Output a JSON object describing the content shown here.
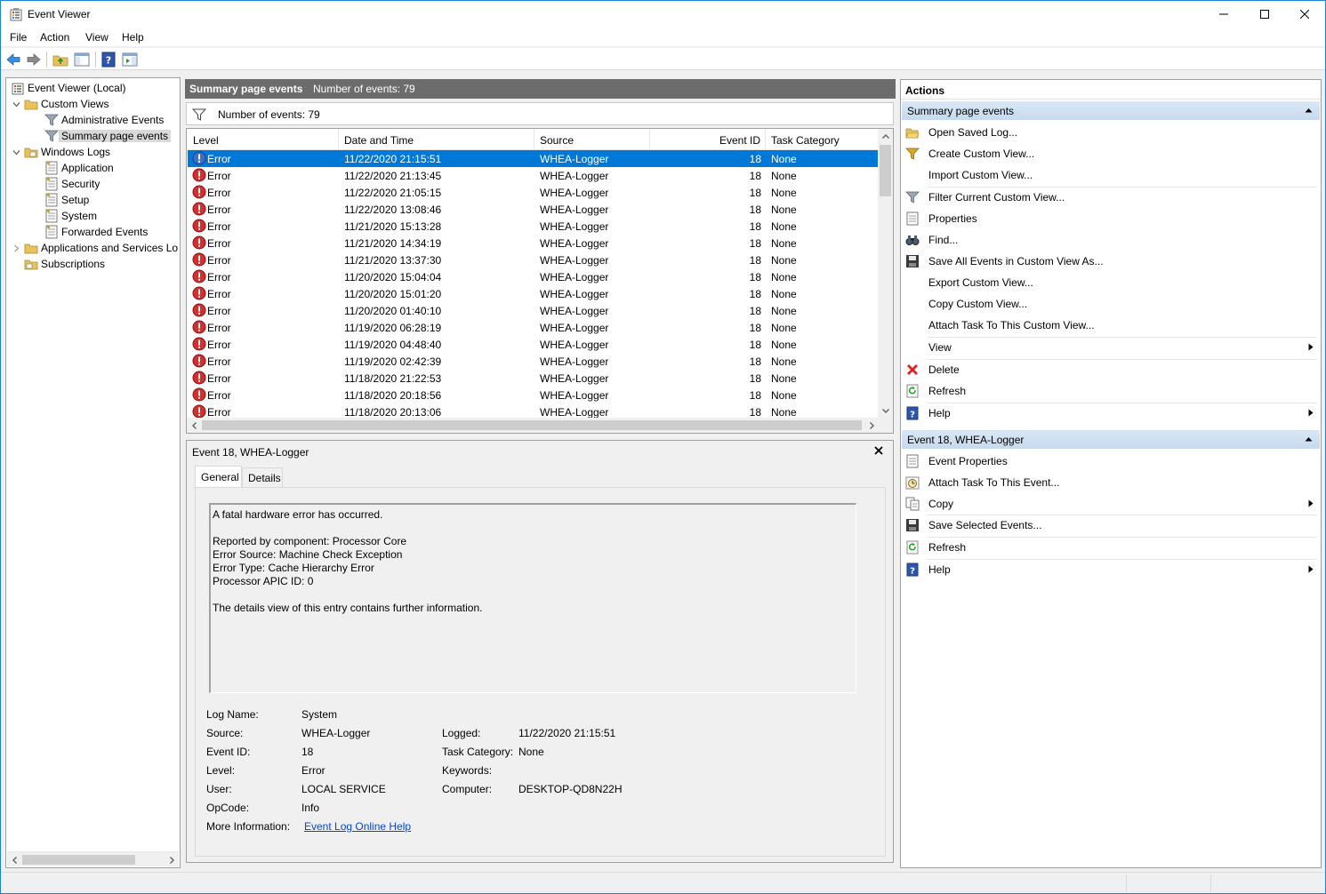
{
  "window": {
    "title": "Event Viewer"
  },
  "menubar": [
    "File",
    "Action",
    "View",
    "Help"
  ],
  "tree": {
    "root": "Event Viewer (Local)",
    "custom_views": "Custom Views",
    "administrative_events": "Administrative Events",
    "summary_page_events": "Summary page events",
    "windows_logs": "Windows Logs",
    "application": "Application",
    "security": "Security",
    "setup": "Setup",
    "system": "System",
    "forwarded_events": "Forwarded Events",
    "apps_services": "Applications and Services Lo",
    "subscriptions": "Subscriptions"
  },
  "center": {
    "title": "Summary page events",
    "count_header": "Number of events: 79",
    "filter_text": "Number of events: 79"
  },
  "grid": {
    "columns": [
      "Level",
      "Date and Time",
      "Source",
      "Event ID",
      "Task Category"
    ],
    "rows": [
      {
        "level": "Error",
        "datetime": "11/22/2020 21:15:51",
        "source": "WHEA-Logger",
        "event_id": "18",
        "task": "None"
      },
      {
        "level": "Error",
        "datetime": "11/22/2020 21:13:45",
        "source": "WHEA-Logger",
        "event_id": "18",
        "task": "None"
      },
      {
        "level": "Error",
        "datetime": "11/22/2020 21:05:15",
        "source": "WHEA-Logger",
        "event_id": "18",
        "task": "None"
      },
      {
        "level": "Error",
        "datetime": "11/22/2020 13:08:46",
        "source": "WHEA-Logger",
        "event_id": "18",
        "task": "None"
      },
      {
        "level": "Error",
        "datetime": "11/21/2020 15:13:28",
        "source": "WHEA-Logger",
        "event_id": "18",
        "task": "None"
      },
      {
        "level": "Error",
        "datetime": "11/21/2020 14:34:19",
        "source": "WHEA-Logger",
        "event_id": "18",
        "task": "None"
      },
      {
        "level": "Error",
        "datetime": "11/21/2020 13:37:30",
        "source": "WHEA-Logger",
        "event_id": "18",
        "task": "None"
      },
      {
        "level": "Error",
        "datetime": "11/20/2020 15:04:04",
        "source": "WHEA-Logger",
        "event_id": "18",
        "task": "None"
      },
      {
        "level": "Error",
        "datetime": "11/20/2020 15:01:20",
        "source": "WHEA-Logger",
        "event_id": "18",
        "task": "None"
      },
      {
        "level": "Error",
        "datetime": "11/20/2020 01:40:10",
        "source": "WHEA-Logger",
        "event_id": "18",
        "task": "None"
      },
      {
        "level": "Error",
        "datetime": "11/19/2020 06:28:19",
        "source": "WHEA-Logger",
        "event_id": "18",
        "task": "None"
      },
      {
        "level": "Error",
        "datetime": "11/19/2020 04:48:40",
        "source": "WHEA-Logger",
        "event_id": "18",
        "task": "None"
      },
      {
        "level": "Error",
        "datetime": "11/19/2020 02:42:39",
        "source": "WHEA-Logger",
        "event_id": "18",
        "task": "None"
      },
      {
        "level": "Error",
        "datetime": "11/18/2020 21:22:53",
        "source": "WHEA-Logger",
        "event_id": "18",
        "task": "None"
      },
      {
        "level": "Error",
        "datetime": "11/18/2020 20:18:56",
        "source": "WHEA-Logger",
        "event_id": "18",
        "task": "None"
      },
      {
        "level": "Error",
        "datetime": "11/18/2020 20:13:06",
        "source": "WHEA-Logger",
        "event_id": "18",
        "task": "None"
      }
    ]
  },
  "detail": {
    "title": "Event 18, WHEA-Logger",
    "tab_general": "General",
    "tab_details": "Details",
    "message_lines": [
      "A fatal hardware error has occurred.",
      "",
      "Reported by component: Processor Core",
      "Error Source: Machine Check Exception",
      "Error Type: Cache Hierarchy Error",
      "Processor APIC ID: 0",
      "",
      "The details view of this entry contains further information."
    ],
    "log_name_label": "Log Name:",
    "log_name": "System",
    "source_label": "Source:",
    "source": "WHEA-Logger",
    "logged_label": "Logged:",
    "logged": "11/22/2020 21:15:51",
    "event_id_label": "Event ID:",
    "event_id": "18",
    "task_category_label": "Task Category:",
    "task_category": "None",
    "level_label": "Level:",
    "level": "Error",
    "keywords_label": "Keywords:",
    "keywords": "",
    "user_label": "User:",
    "user": "LOCAL SERVICE",
    "computer_label": "Computer:",
    "computer": "DESKTOP-QD8N22H",
    "opcode_label": "OpCode:",
    "opcode": "Info",
    "more_info_label": "More Information:",
    "more_info_link": "Event Log Online Help"
  },
  "actions": {
    "header": "Actions",
    "section1": "Summary page events",
    "open_saved_log": "Open Saved Log...",
    "create_custom_view": "Create Custom View...",
    "import_custom_view": "Import Custom View...",
    "filter_current": "Filter Current Custom View...",
    "properties": "Properties",
    "find": "Find...",
    "save_all": "Save All Events in Custom View As...",
    "export": "Export Custom View...",
    "copy_custom": "Copy Custom View...",
    "attach_task_view": "Attach Task To This Custom View...",
    "view": "View",
    "delete": "Delete",
    "refresh": "Refresh",
    "help": "Help",
    "section2": "Event 18, WHEA-Logger",
    "event_properties": "Event Properties",
    "attach_task_event": "Attach Task To This Event...",
    "copy": "Copy",
    "save_selected": "Save Selected Events...",
    "refresh2": "Refresh",
    "help2": "Help"
  },
  "colors": {
    "selection": "#0078d7",
    "header_gray": "#6c6c6c",
    "section_blue": "#c6d9ee",
    "error_red": "#d32f2f",
    "link": "#0645d8"
  }
}
